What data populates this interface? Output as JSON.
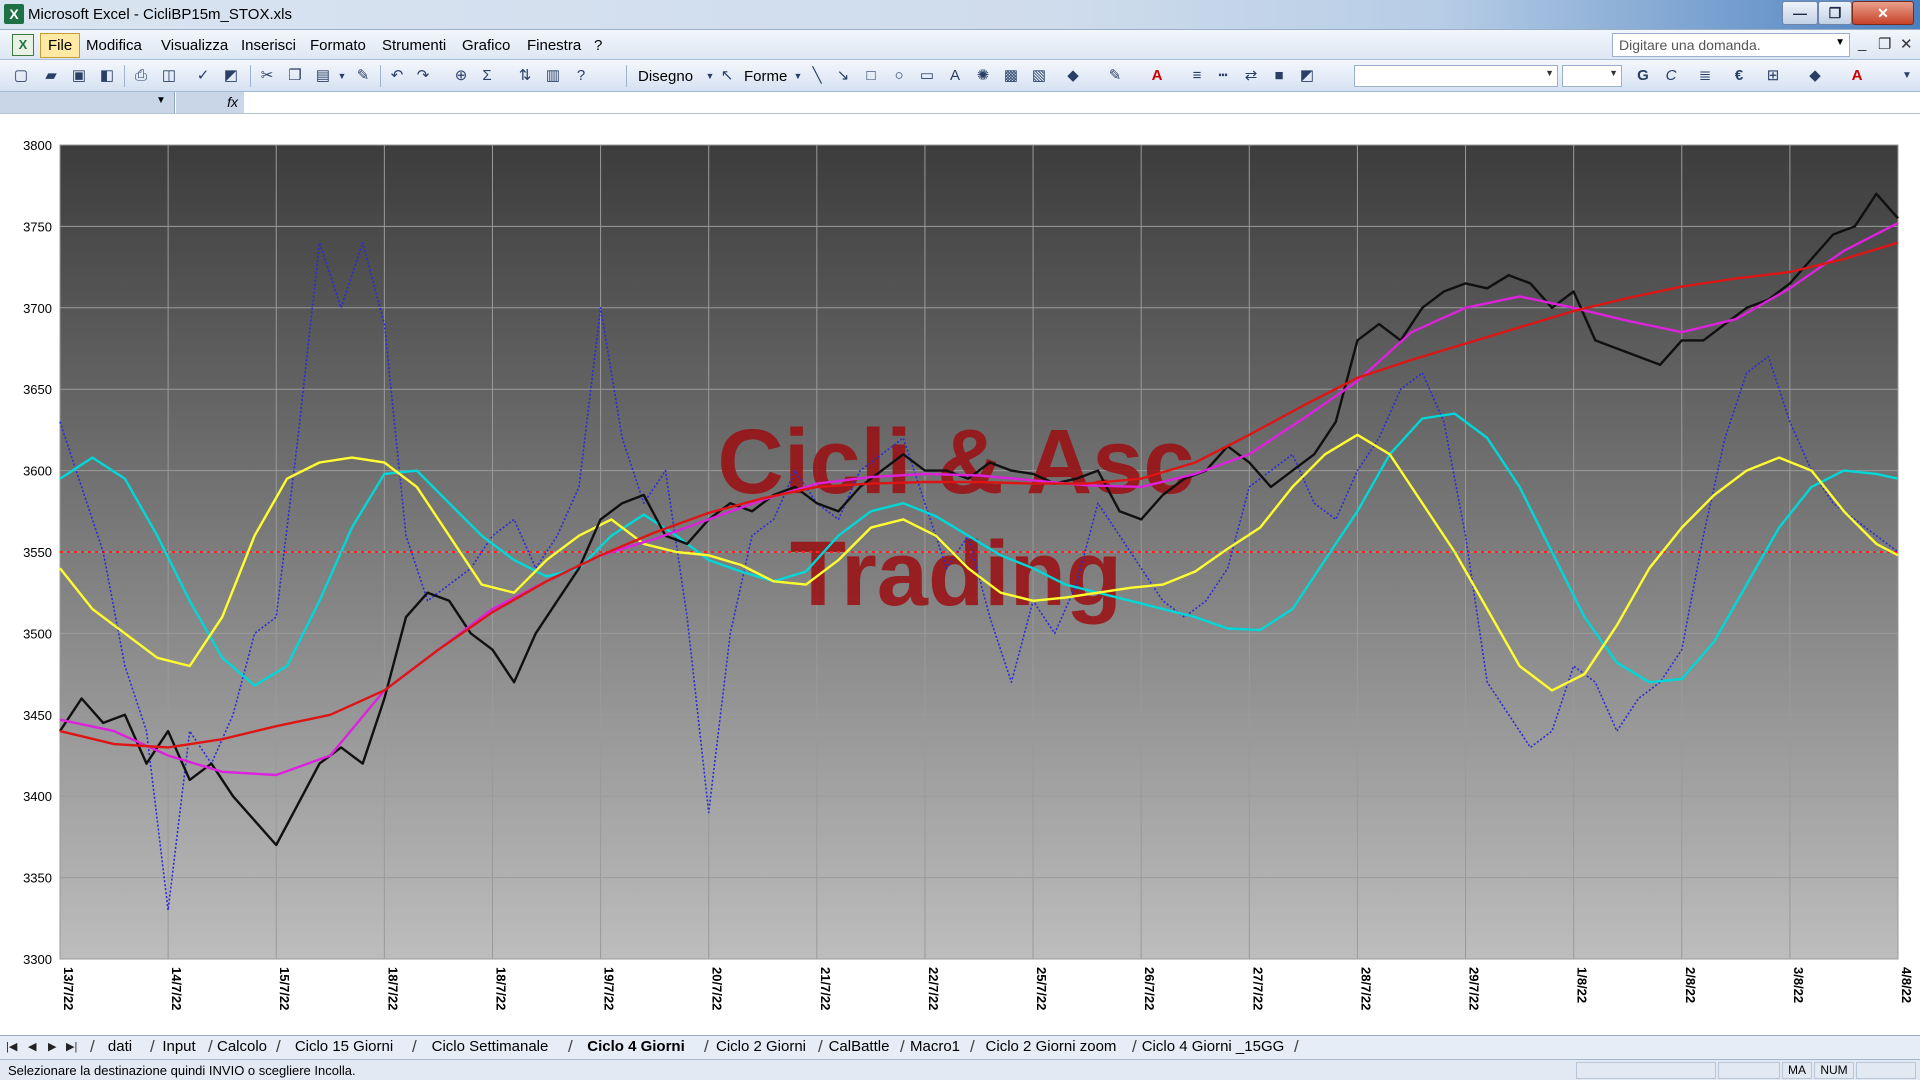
{
  "window": {
    "title": "Microsoft Excel - CicliBP15m_STOX.xls",
    "app_icon": "X",
    "btn_min": "—",
    "btn_max": "❐",
    "btn_close": "✕"
  },
  "menu": {
    "items": [
      "File",
      "Modifica",
      "Visualizza",
      "Inserisci",
      "Formato",
      "Strumenti",
      "Grafico",
      "Finestra",
      "?"
    ],
    "help_placeholder": "Digitare una domanda.",
    "minimize": "_",
    "restore": "❐",
    "close": "✕"
  },
  "toolbar": {
    "disegno": "Disegno",
    "forme": "Forme"
  },
  "sheets": {
    "tabs": [
      "dati",
      "Input",
      "Calcolo",
      "Ciclo 15 Giorni",
      "Ciclo Settimanale",
      "Ciclo 4 Giorni",
      "Ciclo 2 Giorni",
      "CalBattle",
      "Macro1",
      "Ciclo 2 Giorni zoom",
      "Ciclo 4 Giorni _15GG"
    ],
    "active": "Ciclo 4 Giorni"
  },
  "status": {
    "message": "Selezionare la destinazione quindi INVIO o scegliere Incolla.",
    "ma": "MA",
    "num": "NUM"
  },
  "chart_data": {
    "type": "line",
    "watermark": [
      "Cicli & Asc",
      "Trading"
    ],
    "ylim": [
      3300,
      3800
    ],
    "yticks": [
      3300,
      3350,
      3400,
      3450,
      3500,
      3550,
      3600,
      3650,
      3700,
      3750,
      3800
    ],
    "xlim": [
      0,
      17
    ],
    "categories": [
      "13/7/22",
      "14/7/22",
      "15/7/22",
      "18/7/22",
      "18/7/22",
      "19/7/22",
      "20/7/22",
      "21/7/22",
      "22/7/22",
      "25/7/22",
      "26/7/22",
      "27/7/22",
      "28/7/22",
      "29/7/22",
      "1/8/22",
      "2/8/22",
      "3/8/22",
      "4/8/22"
    ],
    "grid": true,
    "reference_line": {
      "y": 3550,
      "color": "#ff2020",
      "style": "dotted"
    },
    "colors": {
      "background_top": "#3c3c3c",
      "background_bottom": "#bdbdbd",
      "watermark": "#9b0d10"
    },
    "series": [
      {
        "color": "#2b2bd8",
        "style": "dotted",
        "x": [
          0,
          0.2,
          0.4,
          0.6,
          0.8,
          1.0,
          1.2,
          1.4,
          1.6,
          1.8,
          2.0,
          2.2,
          2.4,
          2.6,
          2.8,
          3.0,
          3.2,
          3.4,
          3.6,
          3.8,
          4.0,
          4.2,
          4.4,
          4.6,
          4.8,
          5.0,
          5.2,
          5.4,
          5.6,
          5.8,
          6.0,
          6.2,
          6.4,
          6.6,
          6.8,
          7.0,
          7.2,
          7.4,
          7.6,
          7.8,
          8.0,
          8.2,
          8.4,
          8.6,
          8.8,
          9.0,
          9.2,
          9.4,
          9.6,
          9.8,
          10.0,
          10.2,
          10.4,
          10.6,
          10.8,
          11.0,
          11.2,
          11.4,
          11.6,
          11.8,
          12.0,
          12.2,
          12.4,
          12.6,
          12.8,
          13.0,
          13.2,
          13.4,
          13.6,
          13.8,
          14.0,
          14.2,
          14.4,
          14.6,
          14.8,
          15.0,
          15.2,
          15.4,
          15.6,
          15.8,
          16.0,
          16.2,
          16.4,
          16.6,
          16.8,
          17.0
        ],
        "values": [
          3630,
          3590,
          3550,
          3480,
          3440,
          3330,
          3440,
          3420,
          3450,
          3500,
          3510,
          3620,
          3740,
          3700,
          3740,
          3690,
          3560,
          3520,
          3530,
          3540,
          3560,
          3570,
          3540,
          3560,
          3590,
          3700,
          3620,
          3580,
          3600,
          3510,
          3390,
          3500,
          3560,
          3570,
          3600,
          3580,
          3570,
          3600,
          3610,
          3620,
          3580,
          3540,
          3560,
          3510,
          3470,
          3520,
          3500,
          3530,
          3580,
          3560,
          3540,
          3520,
          3510,
          3520,
          3540,
          3590,
          3600,
          3610,
          3580,
          3570,
          3600,
          3620,
          3650,
          3660,
          3630,
          3560,
          3470,
          3450,
          3430,
          3440,
          3480,
          3470,
          3440,
          3460,
          3470,
          3490,
          3560,
          3620,
          3660,
          3670,
          3630,
          3600,
          3580,
          3570,
          3560,
          3550
        ]
      },
      {
        "color": "#00d8d8",
        "x": [
          0,
          0.3,
          0.6,
          0.9,
          1.2,
          1.5,
          1.8,
          2.1,
          2.4,
          2.7,
          3.0,
          3.3,
          3.6,
          3.9,
          4.2,
          4.5,
          4.8,
          5.1,
          5.4,
          5.7,
          6.0,
          6.3,
          6.6,
          6.9,
          7.2,
          7.5,
          7.8,
          8.1,
          8.4,
          8.7,
          9.0,
          9.3,
          9.6,
          9.9,
          10.2,
          10.5,
          10.8,
          11.1,
          11.4,
          11.7,
          12.0,
          12.3,
          12.6,
          12.9,
          13.2,
          13.5,
          13.8,
          14.1,
          14.4,
          14.7,
          15.0,
          15.3,
          15.6,
          15.9,
          16.2,
          16.5,
          16.8,
          17.0
        ],
        "values": [
          3595,
          3608,
          3595,
          3560,
          3520,
          3485,
          3468,
          3480,
          3520,
          3565,
          3598,
          3600,
          3580,
          3560,
          3545,
          3535,
          3540,
          3560,
          3573,
          3560,
          3545,
          3538,
          3532,
          3538,
          3560,
          3575,
          3580,
          3572,
          3560,
          3548,
          3540,
          3530,
          3525,
          3520,
          3515,
          3510,
          3503,
          3502,
          3515,
          3545,
          3575,
          3610,
          3632,
          3635,
          3620,
          3590,
          3550,
          3510,
          3482,
          3470,
          3472,
          3495,
          3530,
          3565,
          3590,
          3600,
          3598,
          3595
        ]
      },
      {
        "color": "#ffff30",
        "x": [
          0,
          0.3,
          0.6,
          0.9,
          1.2,
          1.5,
          1.8,
          2.1,
          2.4,
          2.7,
          3.0,
          3.3,
          3.6,
          3.9,
          4.2,
          4.5,
          4.8,
          5.1,
          5.4,
          5.7,
          6.0,
          6.3,
          6.6,
          6.9,
          7.2,
          7.5,
          7.8,
          8.1,
          8.4,
          8.7,
          9.0,
          9.3,
          9.6,
          9.9,
          10.2,
          10.5,
          10.8,
          11.1,
          11.4,
          11.7,
          12.0,
          12.3,
          12.6,
          12.9,
          13.2,
          13.5,
          13.8,
          14.1,
          14.4,
          14.7,
          15.0,
          15.3,
          15.6,
          15.9,
          16.2,
          16.5,
          16.8,
          17.0
        ],
        "values": [
          3540,
          3515,
          3500,
          3485,
          3480,
          3510,
          3560,
          3595,
          3605,
          3608,
          3605,
          3590,
          3560,
          3530,
          3525,
          3545,
          3560,
          3570,
          3555,
          3550,
          3548,
          3542,
          3532,
          3530,
          3545,
          3565,
          3570,
          3560,
          3540,
          3525,
          3520,
          3522,
          3525,
          3528,
          3530,
          3538,
          3552,
          3565,
          3590,
          3610,
          3622,
          3610,
          3580,
          3550,
          3515,
          3480,
          3465,
          3475,
          3505,
          3540,
          3565,
          3585,
          3600,
          3608,
          3600,
          3575,
          3555,
          3548
        ]
      },
      {
        "color": "#101010",
        "x": [
          0,
          0.2,
          0.4,
          0.6,
          0.8,
          1.0,
          1.2,
          1.4,
          1.6,
          1.8,
          2.0,
          2.2,
          2.4,
          2.6,
          2.8,
          3.0,
          3.2,
          3.4,
          3.6,
          3.8,
          4.0,
          4.2,
          4.4,
          4.6,
          4.8,
          5.0,
          5.2,
          5.4,
          5.6,
          5.8,
          6.0,
          6.2,
          6.4,
          6.6,
          6.8,
          7.0,
          7.2,
          7.4,
          7.6,
          7.8,
          8.0,
          8.2,
          8.4,
          8.6,
          8.8,
          9.0,
          9.2,
          9.4,
          9.6,
          9.8,
          10.0,
          10.2,
          10.4,
          10.6,
          10.8,
          11.0,
          11.2,
          11.4,
          11.6,
          11.8,
          12.0,
          12.2,
          12.4,
          12.6,
          12.8,
          13.0,
          13.2,
          13.4,
          13.6,
          13.8,
          14.0,
          14.2,
          14.4,
          14.6,
          14.8,
          15.0,
          15.2,
          15.4,
          15.6,
          15.8,
          16.0,
          16.2,
          16.4,
          16.6,
          16.8,
          17.0
        ],
        "values": [
          3440,
          3460,
          3445,
          3450,
          3420,
          3440,
          3410,
          3420,
          3400,
          3385,
          3370,
          3395,
          3420,
          3430,
          3420,
          3460,
          3510,
          3525,
          3520,
          3500,
          3490,
          3470,
          3500,
          3520,
          3540,
          3570,
          3580,
          3585,
          3560,
          3555,
          3570,
          3580,
          3575,
          3585,
          3590,
          3580,
          3575,
          3590,
          3600,
          3610,
          3600,
          3600,
          3595,
          3605,
          3600,
          3598,
          3592,
          3595,
          3600,
          3575,
          3570,
          3585,
          3595,
          3600,
          3615,
          3605,
          3590,
          3600,
          3610,
          3630,
          3680,
          3690,
          3680,
          3700,
          3710,
          3715,
          3712,
          3720,
          3715,
          3700,
          3710,
          3680,
          3675,
          3670,
          3665,
          3680,
          3680,
          3690,
          3700,
          3705,
          3715,
          3730,
          3745,
          3750,
          3770,
          3755
        ]
      },
      {
        "color": "#dd22dd",
        "x": [
          0,
          0.5,
          1.0,
          1.5,
          2.0,
          2.5,
          3.0,
          3.5,
          4.0,
          4.5,
          5.0,
          5.5,
          6.0,
          6.5,
          7.0,
          7.5,
          8.0,
          8.5,
          9.0,
          9.5,
          10.0,
          10.5,
          11.0,
          11.5,
          12.0,
          12.5,
          13.0,
          13.5,
          14.0,
          14.5,
          15.0,
          15.5,
          16.0,
          16.5,
          17.0
        ],
        "values": [
          3447,
          3440,
          3425,
          3415,
          3413,
          3425,
          3465,
          3490,
          3515,
          3532,
          3548,
          3558,
          3570,
          3582,
          3592,
          3596,
          3598,
          3597,
          3594,
          3591,
          3590,
          3598,
          3610,
          3632,
          3655,
          3685,
          3700,
          3707,
          3700,
          3692,
          3685,
          3693,
          3712,
          3735,
          3752
        ]
      },
      {
        "color": "#dd1515",
        "x": [
          0,
          0.5,
          1.0,
          1.5,
          2.0,
          2.5,
          3.0,
          3.5,
          4.0,
          4.5,
          5.0,
          5.5,
          6.0,
          6.5,
          7.0,
          7.5,
          8.0,
          8.5,
          9.0,
          9.5,
          10.0,
          10.5,
          11.0,
          11.5,
          12.0,
          12.5,
          13.0,
          13.5,
          14.0,
          14.5,
          15.0,
          15.5,
          16.0,
          16.5,
          17.0
        ],
        "values": [
          3440,
          3432,
          3430,
          3435,
          3443,
          3450,
          3465,
          3490,
          3513,
          3532,
          3548,
          3562,
          3574,
          3583,
          3590,
          3592,
          3593,
          3593,
          3592,
          3592,
          3595,
          3605,
          3622,
          3640,
          3657,
          3668,
          3678,
          3688,
          3698,
          3706,
          3713,
          3718,
          3722,
          3730,
          3740
        ]
      }
    ]
  }
}
